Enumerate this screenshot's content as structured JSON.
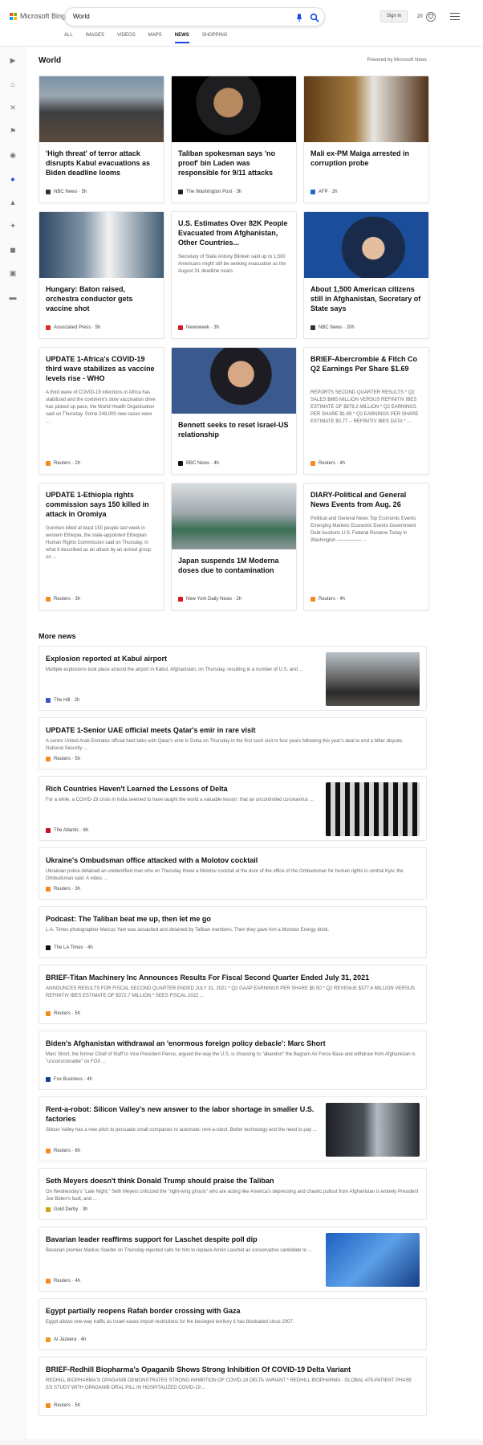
{
  "app": {
    "logo": "Microsoft Bing",
    "query": "World",
    "signin": "Sign in",
    "rewards": "20"
  },
  "tabs": [
    "ALL",
    "IMAGES",
    "VIDEOS",
    "MAPS",
    "NEWS",
    "SHOPPING"
  ],
  "active_tab": "NEWS",
  "sidebar": [
    "toggle-icon",
    "home-icon",
    "random-icon",
    "flag-icon",
    "location-icon",
    "globe-icon",
    "business-icon",
    "science-icon",
    "sports-icon",
    "entertainment-icon",
    "money-icon"
  ],
  "section": {
    "title": "World",
    "powered": "Powered by Microsoft News"
  },
  "cards": [
    {
      "title": "'High threat' of terror attack disrupts Kabul evacuations as Biden deadline looms",
      "snippet": "",
      "source": "NBC News · 5h",
      "img": "crowd",
      "icon_color": "#333"
    },
    {
      "title": "Taliban spokesman says 'no proof' bin Laden was responsible for 9/11 attacks",
      "snippet": "",
      "source": "The Washington Post · 3h",
      "img": "portrait",
      "icon_color": "#222"
    },
    {
      "title": "Mali ex-PM Maiga arrested in corruption probe",
      "snippet": "",
      "source": "AFP · 2h",
      "img": "mali",
      "icon_color": "#1b6ac9"
    },
    {
      "title": "Hungary: Baton raised, orchestra conductor gets vaccine shot",
      "snippet": "",
      "source": "Associated Press · 5h",
      "img": "doctor",
      "icon_color": "#d92b2b"
    },
    {
      "title": "U.S. Estimates Over 82K People Evacuated from Afghanistan, Other Countries...",
      "snippet": "Secretary of State Antony Blinken said up to 1,500 Americans might still be seeking evacuation as the August 31 deadline nears.",
      "source": "Newsweek · 3h",
      "img": "",
      "icon_color": "#d71920"
    },
    {
      "title": "About 1,500 American citizens still in Afghanistan, Secretary of State says",
      "snippet": "",
      "source": "NBC News · 20h",
      "img": "blinken",
      "icon_color": "#333"
    },
    {
      "title": "UPDATE 1-Africa's COVID-19 third wave stabilizes as vaccine levels rise - WHO",
      "snippet": "A third wave of COVID-19 infections in Africa has stabilized and the continent's slow vaccination drive has picked up pace, the World Health Organisation said on Thursday. Some 248,000 new cases were ...",
      "source": "Reuters · 2h",
      "img": "",
      "icon_color": "#f58a22"
    },
    {
      "title": "Bennett seeks to reset Israel-US relationship",
      "snippet": "",
      "source": "BBC News · 4h",
      "img": "bennett",
      "icon_color": "#111"
    },
    {
      "title": "BRIEF-Abercrombie & Fitch Co Q2 Earnings Per Share $1.69",
      "snippet": "REPORTS SECOND QUARTER RESULTS * Q2 SALES $865 MILLION VERSUS REFINITIV IBES ESTIMATE OF $879.2 MILLION * Q2 EARNINGS PER SHARE $1.69 * Q2 EARNINGS PER SHARE ESTIMATE $0.77 -- REFINITIV IBES DATA * ...",
      "source": "Reuters · 4h",
      "img": "",
      "icon_color": "#f58a22"
    },
    {
      "title": "UPDATE 1-Ethiopia rights commission says 150 killed in attack in Oromiya",
      "snippet": "Gunmen killed at least 150 people last week in western Ethiopia, the state-appointed Ethiopian Human Rights Commission said on Thursday, in what it described as an attack by an armed group on ...",
      "source": "Reuters · 3h",
      "img": "",
      "icon_color": "#f58a22"
    },
    {
      "title": "Japan suspends 1M Moderna doses due to contamination",
      "snippet": "",
      "source": "New York Daily News · 2h",
      "img": "japan",
      "icon_color": "#d71920"
    },
    {
      "title": "DIARY-Political and General News Events from Aug. 26",
      "snippet": "Political and General News Top Economic Events Emerging Markets Economic Events Government Debt Auctions U.S. Federal Reserve Today in Washington ————— ...",
      "source": "Reuters · 4h",
      "img": "",
      "icon_color": "#f58a22"
    }
  ],
  "more": {
    "title": "More news",
    "items": [
      {
        "title": "Explosion reported at Kabul airport",
        "snippet": "Multiple explosions took place around the airport in Kabul, Afghanistan, on Thursday, resulting in a number of U.S. and ...",
        "source": "The Hill · 2h",
        "img": "kabul",
        "icon_color": "#3a57c4"
      },
      {
        "title": "UPDATE 1-Senior UAE official meets Qatar's emir in rare visit",
        "snippet": "A senior United Arab Emirates official held talks with Qatar's emir in Doha on Thursday in the first such visit in four years following this year's deal to end a bitter dispute. National Security ...",
        "source": "Reuters · 5h",
        "img": "",
        "icon_color": "#f58a22"
      },
      {
        "title": "Rich Countries Haven't Learned the Lessons of Delta",
        "snippet": "For a while, a COVID-19 crisis in India seemed to have taught the world a valuable lesson: that an uncontrolled coronavirus ...",
        "source": "The Atlantic · 6h",
        "img": "delta",
        "icon_color": "#c8102e"
      },
      {
        "title": "Ukraine's Ombudsman office attacked with a Molotov cocktail",
        "snippet": "Ukrainian police detained an unidentified man who on Thursday threw a Molotov cocktail at the door of the office of the Ombudsman for human rights in central Kyiv, the Ombudsman said. A video, ...",
        "source": "Reuters · 3h",
        "img": "",
        "icon_color": "#f58a22"
      },
      {
        "title": "Podcast: The Taliban beat me up, then let me go",
        "snippet": "L.A. Times photographer Marcus Yam was assaulted and detained by Taliban members. Then they gave him a Monster Energy drink.",
        "source": "The LA Times · 4h",
        "img": "",
        "icon_color": "#111"
      },
      {
        "title": "BRIEF-Titan Machinery Inc Announces Results For Fiscal Second Quarter Ended July 31, 2021",
        "snippet": "ANNOUNCES RESULTS FOR FISCAL SECOND QUARTER ENDED JULY 31, 2021 * Q2 GAAP EARNINGS PER SHARE $0.50 * Q2 REVENUE $377.6 MILLION VERSUS REFINITIV IBES ESTIMATE OF $372.7 MILLION * SEES FISCAL 2022 ...",
        "source": "Reuters · 5h",
        "img": "",
        "icon_color": "#f58a22"
      },
      {
        "title": "Biden's Afghanistan withdrawal an 'enormous foreign policy debacle': Marc Short",
        "snippet": "Marc Short, the former Chief of Staff to Vice President Pence, argued the way the U.S. is choosing to \"abandon\" the Bagram Air Force Base and withdraw from Afghanistan is \"unconscionable\" on FOX ...",
        "source": "Fox Business · 4h",
        "img": "",
        "icon_color": "#1c3f94"
      },
      {
        "title": "Rent-a-robot: Silicon Valley's new answer to the labor shortage in smaller U.S. factories",
        "snippet": "Silicon Valley has a new pitch to persuade small companies to automate: rent-a-robot. Better technology and the need to pay ...",
        "source": "Reuters · 6h",
        "img": "robot",
        "icon_color": "#f58a22"
      },
      {
        "title": "Seth Meyers doesn't think Donald Trump should praise the Taliban",
        "snippet": "On Wednesday's \"Late Night,\" Seth Meyers criticized the \"right-wing ghouls\" who are acting like America's depressing and chaotic pullout from Afghanistan is entirely President Joe Biden's fault, and ...",
        "source": "Gold Derby · 3h",
        "img": "",
        "icon_color": "#d4a017"
      },
      {
        "title": "Bavarian leader reaffirms support for Laschet despite poll dip",
        "snippet": "Bavarian premier Markus Soeder on Thursday rejected calls for him to replace Armin Laschet as conservative candidate to ...",
        "source": "Reuters · 4h",
        "img": "bavaria",
        "icon_color": "#f58a22"
      },
      {
        "title": "Egypt partially reopens Rafah border crossing with Gaza",
        "snippet": "Egypt allows one-way traffic as Israel eases import restrictions for the besieged territory it has blockaded since 2007.",
        "source": "Al Jazeera · 4h",
        "img": "",
        "icon_color": "#e89b1c"
      },
      {
        "title": "BRIEF-Redhill Biopharma's Opaganib Shows Strong Inhibition Of COVID-19 Delta Variant",
        "snippet": "REDHILL BIOPHARMA'S OPAGANIB DEMONSTRATES STRONG INHIBITION OF COVID-19 DELTA VARIANT * REDHILL BIOPHARMA - GLOBAL 475-PATIENT PHASE 2/3 STUDY WITH OPAGANIB ORAL PILL IN HOSPITALIZED COVID-19 ...",
        "source": "Reuters · 5h",
        "img": "",
        "icon_color": "#f58a22"
      }
    ]
  }
}
